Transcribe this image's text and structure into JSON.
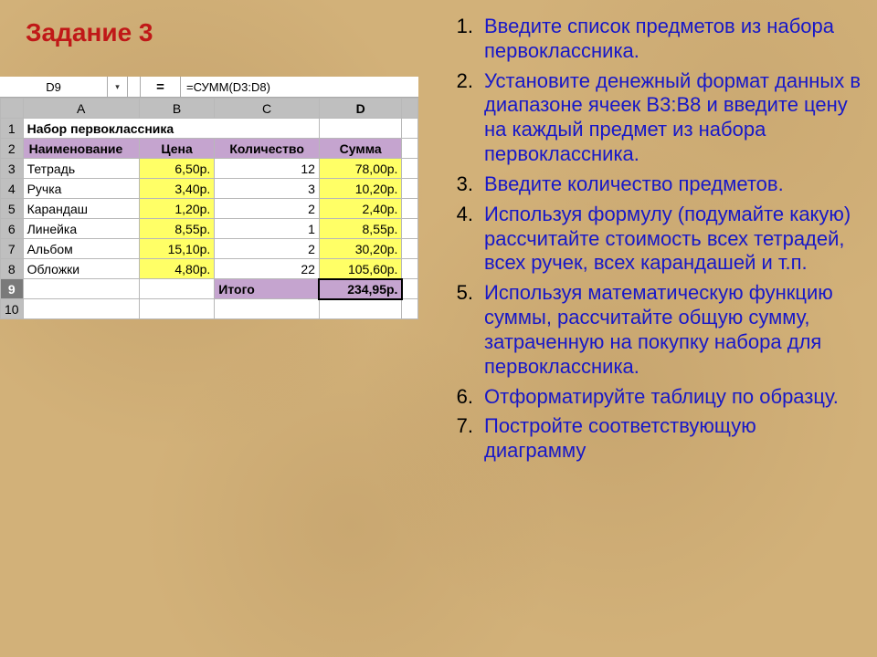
{
  "title": "Задание 3",
  "formula_bar": {
    "cell_ref": "D9",
    "dropdown_glyph": "▾",
    "eq": "=",
    "formula": "=СУММ(D3:D8)"
  },
  "columns": [
    "A",
    "B",
    "C",
    "D"
  ],
  "row_numbers": [
    "1",
    "2",
    "3",
    "4",
    "5",
    "6",
    "7",
    "8",
    "9",
    "10"
  ],
  "selected_row": "9",
  "r1": {
    "a": "Набор первоклассника"
  },
  "r2": {
    "a": "Наименование",
    "b": "Цена",
    "c": "Количество",
    "d": "Сумма"
  },
  "data_rows": [
    {
      "a": "Тетрадь",
      "b": "6,50р.",
      "c": "12",
      "d": "78,00р."
    },
    {
      "a": "Ручка",
      "b": "3,40р.",
      "c": "3",
      "d": "10,20р."
    },
    {
      "a": "Карандаш",
      "b": "1,20р.",
      "c": "2",
      "d": "2,40р."
    },
    {
      "a": "Линейка",
      "b": "8,55р.",
      "c": "1",
      "d": "8,55р."
    },
    {
      "a": "Альбом",
      "b": "15,10р.",
      "c": "2",
      "d": "30,20р."
    },
    {
      "a": "Обложки",
      "b": "4,80р.",
      "c": "22",
      "d": "105,60р."
    }
  ],
  "totals": {
    "label": "Итого",
    "value": "234,95р."
  },
  "steps": [
    "Введите список предметов из набора первоклассника.",
    "Установите денежный формат данных в диапазоне ячеек B3:B8 и введите цену на каждый предмет из набора первоклассника.",
    "Введите количество предметов.",
    "Используя формулу (подумайте какую) рассчитайте стоимость всех тетрадей, всех ручек, всех карандашей и т.п.",
    "Используя математическую функцию суммы, рассчитайте общую сумму, затраченную на покупку набора для первоклассника.",
    "Отформатируйте таблицу по образцу.",
    "Постройте соответствующую диаграмму"
  ],
  "chart_data": {
    "type": "table",
    "title": "Набор первоклассника",
    "columns": [
      "Наименование",
      "Цена",
      "Количество",
      "Сумма"
    ],
    "rows": [
      [
        "Тетрадь",
        6.5,
        12,
        78.0
      ],
      [
        "Ручка",
        3.4,
        3,
        10.2
      ],
      [
        "Карандаш",
        1.2,
        2,
        2.4
      ],
      [
        "Линейка",
        8.55,
        1,
        8.55
      ],
      [
        "Альбом",
        15.1,
        2,
        30.2
      ],
      [
        "Обложки",
        4.8,
        22,
        105.6
      ]
    ],
    "total": 234.95,
    "currency": "р."
  }
}
